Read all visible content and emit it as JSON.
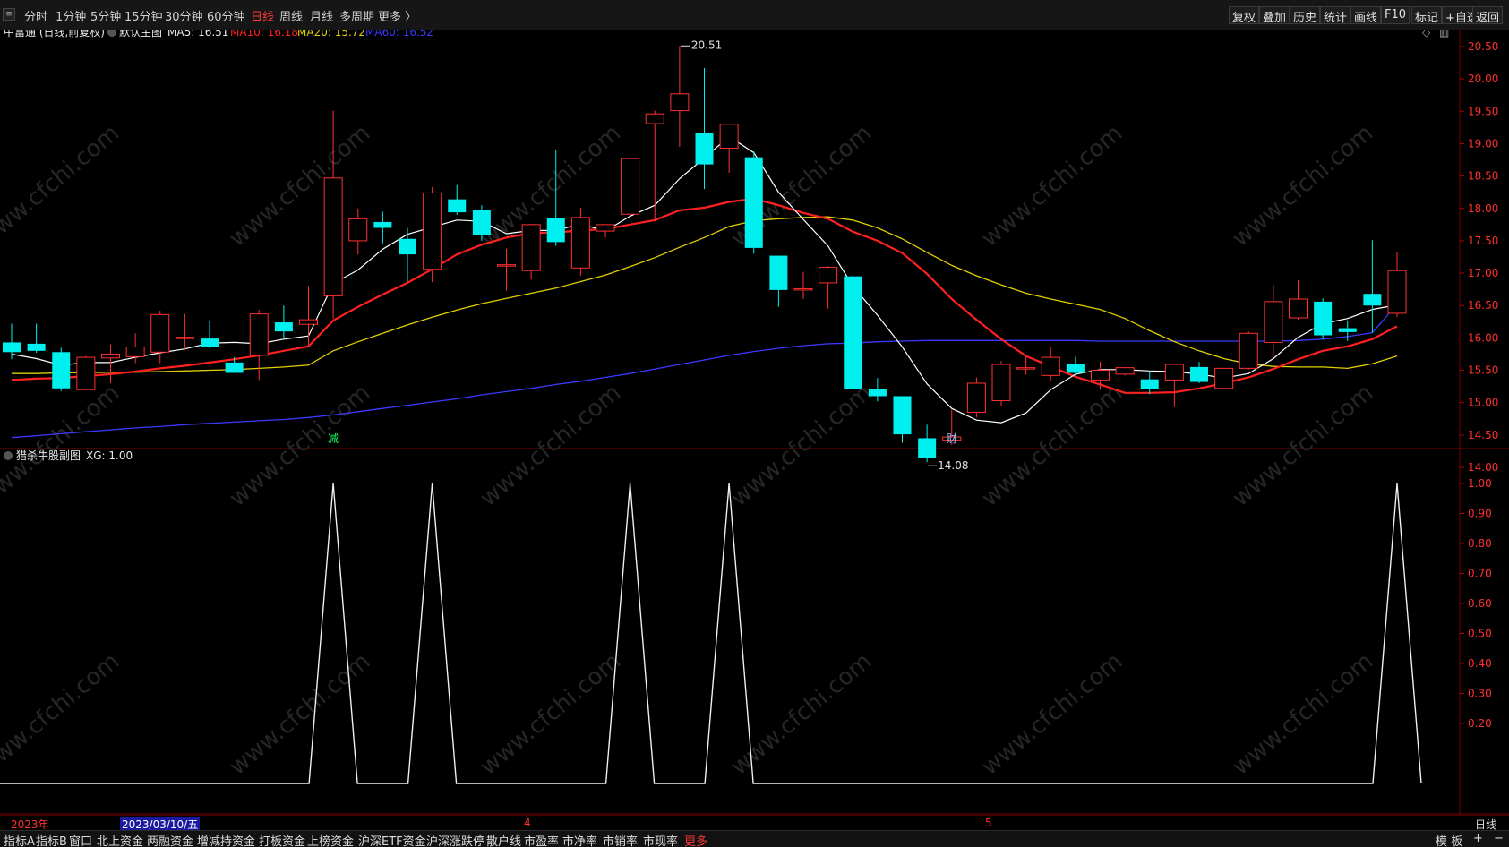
{
  "toolbar": {
    "periods": [
      "分时",
      "1分钟",
      "5分钟",
      "15分钟",
      "30分钟",
      "60分钟",
      "日线",
      "周线",
      "月线",
      "多周期",
      "更多 〉"
    ],
    "active_period": "日线",
    "right_buttons": [
      "复权",
      "叠加",
      "历史",
      "统计",
      "画线",
      "F10",
      "标记",
      "+自选",
      "返回"
    ]
  },
  "main_chart": {
    "stock_title": "中富通 (日线,前复权)",
    "template": "默认主图",
    "ma5": "MA5: 16.51",
    "ma10": "MA10: 16.18",
    "ma20": "MA20: 15.72",
    "ma60": "MA60: 16.52",
    "high_label": "20.51",
    "low_label": "14.08",
    "marker_jian": "减",
    "marker_cai": "财",
    "y_ticks": [
      "20.50",
      "20.00",
      "19.50",
      "19.00",
      "18.50",
      "18.00",
      "17.50",
      "17.00",
      "16.50",
      "16.00",
      "15.50",
      "15.00",
      "14.50",
      "14.00"
    ],
    "colors": {
      "ma5": "#ffffff",
      "ma10": "#ff2020",
      "ma20": "#e0d000",
      "ma60": "#3a3aff",
      "up": "#ff3030",
      "down": "#00f0f0"
    }
  },
  "sub_chart": {
    "title": "猎杀牛股副图",
    "value": "XG: 1.00",
    "y_ticks": [
      "1.00",
      "0.90",
      "0.80",
      "0.70",
      "0.60",
      "0.50",
      "0.40",
      "0.30",
      "0.20"
    ]
  },
  "date_axis": {
    "year": "2023年",
    "cursor_date": "2023/03/10/五",
    "m4": "4",
    "m5": "5"
  },
  "right_label": "日线",
  "bottom_tabs": [
    "指标A",
    "指标B",
    "窗口",
    "北上资金",
    "两融资金",
    "增减持资金",
    "打板资金",
    "上榜资金",
    "沪深ETF资金",
    "沪深涨跌停",
    "散户线",
    "市盈率",
    "市净率",
    "市销率",
    "市现率",
    "更多"
  ],
  "bottom_right": [
    "模 板",
    "+",
    "−"
  ],
  "watermark": "www.cfchi.com",
  "chart_data": {
    "type": "candlestick",
    "candles": [
      {
        "o": 15.93,
        "h": 16.22,
        "l": 15.67,
        "c": 15.78
      },
      {
        "o": 15.91,
        "h": 16.22,
        "l": 15.77,
        "c": 15.8
      },
      {
        "o": 15.78,
        "h": 15.85,
        "l": 15.18,
        "c": 15.22
      },
      {
        "o": 15.2,
        "h": 15.72,
        "l": 15.2,
        "c": 15.7
      },
      {
        "o": 15.69,
        "h": 15.9,
        "l": 15.3,
        "c": 15.75
      },
      {
        "o": 15.71,
        "h": 16.07,
        "l": 15.61,
        "c": 15.86
      },
      {
        "o": 15.78,
        "h": 16.42,
        "l": 15.61,
        "c": 16.36
      },
      {
        "o": 16.0,
        "h": 16.37,
        "l": 15.81,
        "c": 16.01
      },
      {
        "o": 15.99,
        "h": 16.27,
        "l": 15.84,
        "c": 15.86
      },
      {
        "o": 15.62,
        "h": 15.7,
        "l": 15.47,
        "c": 15.46
      },
      {
        "o": 15.73,
        "h": 16.43,
        "l": 15.35,
        "c": 16.37
      },
      {
        "o": 16.24,
        "h": 16.5,
        "l": 15.98,
        "c": 16.1
      },
      {
        "o": 16.21,
        "h": 16.8,
        "l": 15.89,
        "c": 16.28
      },
      {
        "o": 16.65,
        "h": 19.51,
        "l": 16.3,
        "c": 18.47
      },
      {
        "o": 17.5,
        "h": 18.0,
        "l": 17.29,
        "c": 17.84
      },
      {
        "o": 17.79,
        "h": 17.95,
        "l": 17.45,
        "c": 17.7
      },
      {
        "o": 17.53,
        "h": 17.7,
        "l": 16.87,
        "c": 17.29
      },
      {
        "o": 17.06,
        "h": 18.33,
        "l": 16.86,
        "c": 18.24
      },
      {
        "o": 18.14,
        "h": 18.36,
        "l": 17.9,
        "c": 17.94
      },
      {
        "o": 17.97,
        "h": 18.05,
        "l": 17.5,
        "c": 17.59
      },
      {
        "o": 17.12,
        "h": 17.38,
        "l": 16.73,
        "c": 17.13
      },
      {
        "o": 17.04,
        "h": 17.76,
        "l": 16.9,
        "c": 17.75
      },
      {
        "o": 17.85,
        "h": 18.9,
        "l": 17.42,
        "c": 17.48
      },
      {
        "o": 17.08,
        "h": 18.01,
        "l": 16.96,
        "c": 17.86
      },
      {
        "o": 17.65,
        "h": 17.75,
        "l": 17.55,
        "c": 17.75
      },
      {
        "o": 17.91,
        "h": 18.78,
        "l": 17.84,
        "c": 18.77
      },
      {
        "o": 19.31,
        "h": 19.51,
        "l": 17.8,
        "c": 19.46
      },
      {
        "o": 19.51,
        "h": 20.51,
        "l": 18.95,
        "c": 19.77
      },
      {
        "o": 19.17,
        "h": 20.17,
        "l": 18.3,
        "c": 18.68
      },
      {
        "o": 18.93,
        "h": 19.3,
        "l": 18.55,
        "c": 19.3
      },
      {
        "o": 18.79,
        "h": 18.88,
        "l": 17.3,
        "c": 17.39
      },
      {
        "o": 17.27,
        "h": 17.27,
        "l": 16.48,
        "c": 16.74
      },
      {
        "o": 16.75,
        "h": 17.02,
        "l": 16.6,
        "c": 16.76
      },
      {
        "o": 16.85,
        "h": 17.11,
        "l": 16.45,
        "c": 17.09
      },
      {
        "o": 16.95,
        "h": 16.97,
        "l": 15.21,
        "c": 15.21
      },
      {
        "o": 15.21,
        "h": 15.38,
        "l": 15.02,
        "c": 15.1
      },
      {
        "o": 15.1,
        "h": 15.1,
        "l": 14.38,
        "c": 14.51
      },
      {
        "o": 14.45,
        "h": 14.66,
        "l": 14.08,
        "c": 14.14
      },
      {
        "o": 14.42,
        "h": 14.89,
        "l": 14.35,
        "c": 14.47
      },
      {
        "o": 14.85,
        "h": 15.39,
        "l": 14.77,
        "c": 15.3
      },
      {
        "o": 15.03,
        "h": 15.64,
        "l": 14.95,
        "c": 15.59
      },
      {
        "o": 15.54,
        "h": 15.73,
        "l": 15.43,
        "c": 15.54
      },
      {
        "o": 15.42,
        "h": 15.86,
        "l": 15.34,
        "c": 15.7
      },
      {
        "o": 15.6,
        "h": 15.71,
        "l": 15.42,
        "c": 15.46
      },
      {
        "o": 15.35,
        "h": 15.63,
        "l": 15.2,
        "c": 15.5
      },
      {
        "o": 15.44,
        "h": 15.55,
        "l": 15.42,
        "c": 15.54
      },
      {
        "o": 15.36,
        "h": 15.49,
        "l": 15.13,
        "c": 15.21
      },
      {
        "o": 15.35,
        "h": 15.6,
        "l": 14.93,
        "c": 15.59
      },
      {
        "o": 15.55,
        "h": 15.63,
        "l": 15.3,
        "c": 15.32
      },
      {
        "o": 15.22,
        "h": 15.53,
        "l": 15.2,
        "c": 15.53
      },
      {
        "o": 15.53,
        "h": 16.1,
        "l": 15.51,
        "c": 16.07
      },
      {
        "o": 15.93,
        "h": 16.82,
        "l": 15.72,
        "c": 16.56
      },
      {
        "o": 16.31,
        "h": 16.89,
        "l": 16.28,
        "c": 16.6
      },
      {
        "o": 16.56,
        "h": 16.61,
        "l": 15.98,
        "c": 16.04
      },
      {
        "o": 16.15,
        "h": 16.27,
        "l": 15.95,
        "c": 16.09
      },
      {
        "o": 16.68,
        "h": 17.51,
        "l": 16.08,
        "c": 16.5
      },
      {
        "o": 16.38,
        "h": 17.33,
        "l": 16.32,
        "c": 17.04
      }
    ],
    "ma5": [
      15.75,
      15.68,
      15.58,
      15.62,
      15.62,
      15.7,
      15.77,
      15.83,
      15.92,
      15.93,
      15.91,
      15.98,
      16.03,
      16.84,
      17.05,
      17.37,
      17.6,
      17.71,
      17.82,
      17.8,
      17.61,
      17.66,
      17.66,
      17.76,
      17.65,
      17.88,
      18.05,
      18.46,
      18.78,
      19.11,
      18.86,
      18.25,
      17.83,
      17.42,
      16.8,
      16.35,
      15.86,
      15.29,
      14.91,
      14.73,
      14.69,
      14.84,
      15.2,
      15.44,
      15.51,
      15.51,
      15.49,
      15.48,
      15.44,
      15.38,
      15.45,
      15.68,
      16.01,
      16.22,
      16.3,
      16.44,
      16.51
    ],
    "ma10": [
      15.35,
      15.37,
      15.38,
      15.41,
      15.44,
      15.48,
      15.53,
      15.57,
      15.62,
      15.67,
      15.73,
      15.8,
      15.87,
      16.27,
      16.48,
      16.67,
      16.85,
      17.06,
      17.29,
      17.44,
      17.55,
      17.62,
      17.63,
      17.66,
      17.68,
      17.75,
      17.82,
      17.97,
      18.01,
      18.1,
      18.15,
      18.05,
      17.93,
      17.84,
      17.64,
      17.5,
      17.31,
      16.99,
      16.6,
      16.28,
      15.98,
      15.72,
      15.56,
      15.4,
      15.28,
      15.15,
      15.15,
      15.16,
      15.22,
      15.3,
      15.39,
      15.52,
      15.67,
      15.8,
      15.87,
      15.98,
      16.18
    ],
    "ma20": [
      15.45,
      15.45,
      15.46,
      15.46,
      15.47,
      15.47,
      15.48,
      15.49,
      15.5,
      15.51,
      15.53,
      15.55,
      15.58,
      15.8,
      15.94,
      16.07,
      16.2,
      16.32,
      16.43,
      16.53,
      16.61,
      16.69,
      16.77,
      16.87,
      16.97,
      17.1,
      17.24,
      17.4,
      17.55,
      17.72,
      17.81,
      17.84,
      17.86,
      17.87,
      17.82,
      17.7,
      17.53,
      17.32,
      17.12,
      16.96,
      16.82,
      16.69,
      16.6,
      16.52,
      16.44,
      16.3,
      16.11,
      15.94,
      15.8,
      15.68,
      15.6,
      15.56,
      15.55,
      15.55,
      15.53,
      15.6,
      15.72
    ],
    "ma60": [
      14.46,
      14.49,
      14.52,
      14.55,
      14.58,
      14.61,
      14.63,
      14.66,
      14.68,
      14.7,
      14.72,
      14.74,
      14.77,
      14.81,
      14.86,
      14.91,
      14.96,
      15.01,
      15.06,
      15.12,
      15.17,
      15.22,
      15.28,
      15.33,
      15.39,
      15.45,
      15.52,
      15.59,
      15.66,
      15.73,
      15.79,
      15.84,
      15.88,
      15.91,
      15.92,
      15.94,
      15.95,
      15.96,
      15.96,
      15.96,
      15.96,
      15.96,
      15.96,
      15.96,
      15.95,
      15.95,
      15.95,
      15.95,
      15.95,
      15.95,
      15.95,
      15.95,
      15.96,
      15.98,
      16.02,
      16.08,
      16.52
    ],
    "xg": [
      0,
      0,
      0,
      0,
      0,
      0,
      0,
      0,
      0,
      0,
      0,
      0,
      0,
      1,
      0,
      0,
      0,
      1,
      0,
      0,
      0,
      0,
      0,
      0,
      0,
      1,
      0,
      0,
      0,
      1,
      0,
      0,
      0,
      0,
      0,
      0,
      0,
      0,
      0,
      0,
      0,
      0,
      0,
      0,
      0,
      0,
      0,
      0,
      0,
      0,
      0,
      0,
      0,
      0,
      0,
      0,
      1
    ]
  }
}
